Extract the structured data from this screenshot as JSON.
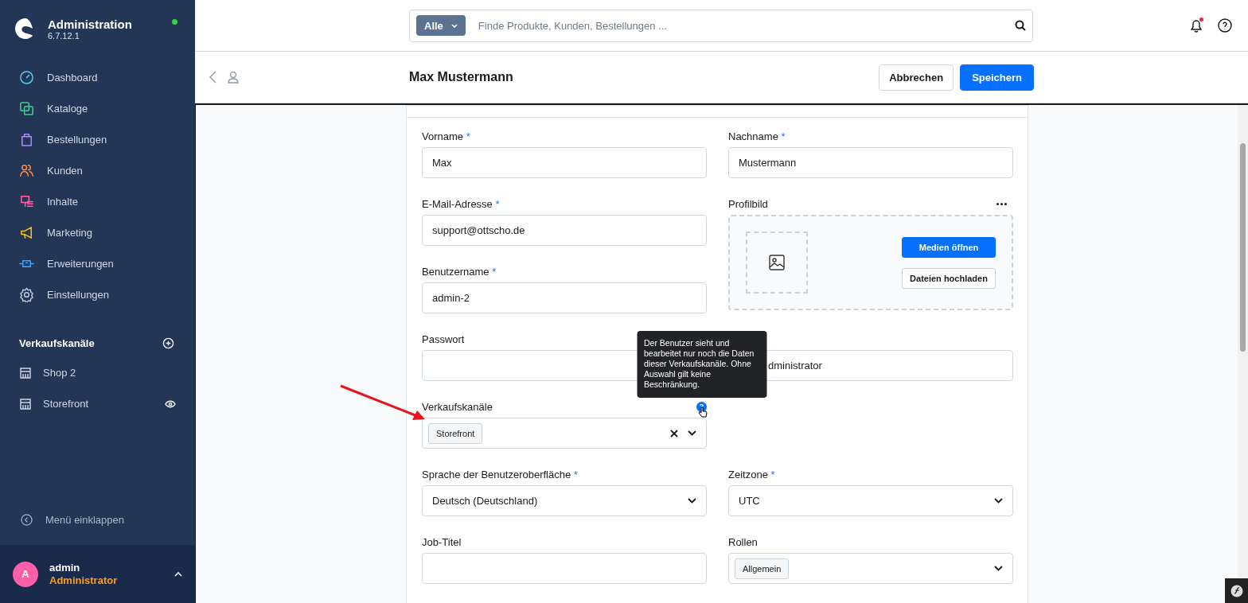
{
  "sidebar": {
    "brand": {
      "title": "Administration",
      "version": "6.7.12.1",
      "online": true
    },
    "nav": [
      {
        "label": "Dashboard"
      },
      {
        "label": "Kataloge"
      },
      {
        "label": "Bestellungen"
      },
      {
        "label": "Kunden"
      },
      {
        "label": "Inhalte"
      },
      {
        "label": "Marketing"
      },
      {
        "label": "Erweiterungen"
      },
      {
        "label": "Einstellungen"
      }
    ],
    "sales_channels": {
      "title": "Verkaufskanäle",
      "items": [
        {
          "label": "Shop 2",
          "visible": false
        },
        {
          "label": "Storefront",
          "visible": true
        }
      ]
    },
    "collapse": "Menü einklappen",
    "user": {
      "initial": "A",
      "name": "admin",
      "role": "Administrator"
    }
  },
  "topbar": {
    "search": {
      "filter": "Alle",
      "placeholder": "Finde Produkte, Kunden, Bestellungen ..."
    },
    "notifications_unread": true
  },
  "header": {
    "title": "Max Mustermann",
    "buttons": [
      {
        "label": "Abbrechen",
        "kind": "secondary"
      },
      {
        "label": "Speichern",
        "kind": "primary"
      }
    ]
  },
  "form": {
    "required_mark": "*",
    "fields": [
      {
        "kind": "text",
        "label": "Vorname",
        "required": true,
        "value": "Max"
      },
      {
        "kind": "text",
        "label": "Nachname",
        "required": true,
        "value": "Mustermann"
      },
      {
        "kind": "text",
        "label": "E-Mail-Adresse",
        "required": true,
        "value": "support@ottscho.de"
      },
      {
        "kind": "media",
        "label": "Profilbild",
        "buttons": [
          "Medien öffnen",
          "Dateien hochladen"
        ]
      },
      {
        "kind": "text",
        "label": "Benutzername",
        "required": true,
        "value": "admin-2"
      },
      {
        "kind": "text",
        "label": "Passwort"
      },
      {
        "kind": "covered",
        "value": "dministrator"
      },
      {
        "kind": "multiselect",
        "label": "Verkaufskanäle",
        "tags": [
          "Storefront"
        ],
        "help_icon": "?",
        "help": "Der Benutzer sieht und bearbeitet nur noch die Daten dieser Verkaufskanäle. Ohne Auswahl gilt keine Beschränkung."
      },
      {
        "kind": "empty"
      },
      {
        "kind": "select",
        "label": "Sprache der Benutzeroberfläche",
        "required": true,
        "value": "Deutsch (Deutschland)"
      },
      {
        "kind": "select",
        "label": "Zeitzone",
        "required": true,
        "value": "UTC"
      },
      {
        "kind": "text",
        "label": "Job-Titel"
      },
      {
        "kind": "multiselect",
        "label": "Rollen",
        "tags": [
          "Allgemein"
        ]
      }
    ]
  }
}
